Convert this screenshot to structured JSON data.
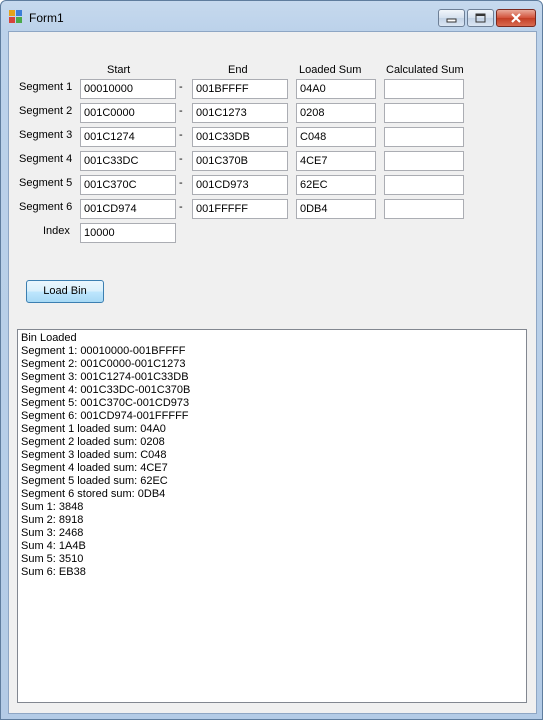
{
  "window": {
    "title": "Form1",
    "icon": "winforms-app-icon"
  },
  "headers": {
    "start": "Start",
    "end": "End",
    "loaded_sum": "Loaded Sum",
    "calculated_sum": "Calculated Sum"
  },
  "segments": [
    {
      "label": "Segment 1",
      "start": "00010000",
      "end": "001BFFFF",
      "loaded_sum": "04A0",
      "calculated_sum": ""
    },
    {
      "label": "Segment 2",
      "start": "001C0000",
      "end": "001C1273",
      "loaded_sum": "0208",
      "calculated_sum": ""
    },
    {
      "label": "Segment 3",
      "start": "001C1274",
      "end": "001C33DB",
      "loaded_sum": "C048",
      "calculated_sum": ""
    },
    {
      "label": "Segment 4",
      "start": "001C33DC",
      "end": "001C370B",
      "loaded_sum": "4CE7",
      "calculated_sum": ""
    },
    {
      "label": "Segment 5",
      "start": "001C370C",
      "end": "001CD973",
      "loaded_sum": "62EC",
      "calculated_sum": ""
    },
    {
      "label": "Segment 6",
      "start": "001CD974",
      "end": "001FFFFF",
      "loaded_sum": "0DB4",
      "calculated_sum": ""
    }
  ],
  "separator": "-",
  "index": {
    "label": "Index",
    "value": "10000"
  },
  "load_button": "Load Bin",
  "log_lines": [
    "Bin Loaded",
    "Segment 1: 00010000-001BFFFF",
    "Segment 2: 001C0000-001C1273",
    "Segment 3: 001C1274-001C33DB",
    "Segment 4: 001C33DC-001C370B",
    "Segment 5: 001C370C-001CD973",
    "Segment 6: 001CD974-001FFFFF",
    "Segment 1 loaded sum: 04A0",
    "Segment 2 loaded sum: 0208",
    "Segment 3 loaded sum: C048",
    "Segment 4 loaded sum: 4CE7",
    "Segment 5 loaded sum: 62EC",
    "Segment 6 stored sum: 0DB4",
    "Sum 1: 3848",
    "Sum 2: 8918",
    "Sum 3: 2468",
    "Sum 4: 1A4B",
    "Sum 5: 3510",
    "Sum 6: EB38"
  ]
}
